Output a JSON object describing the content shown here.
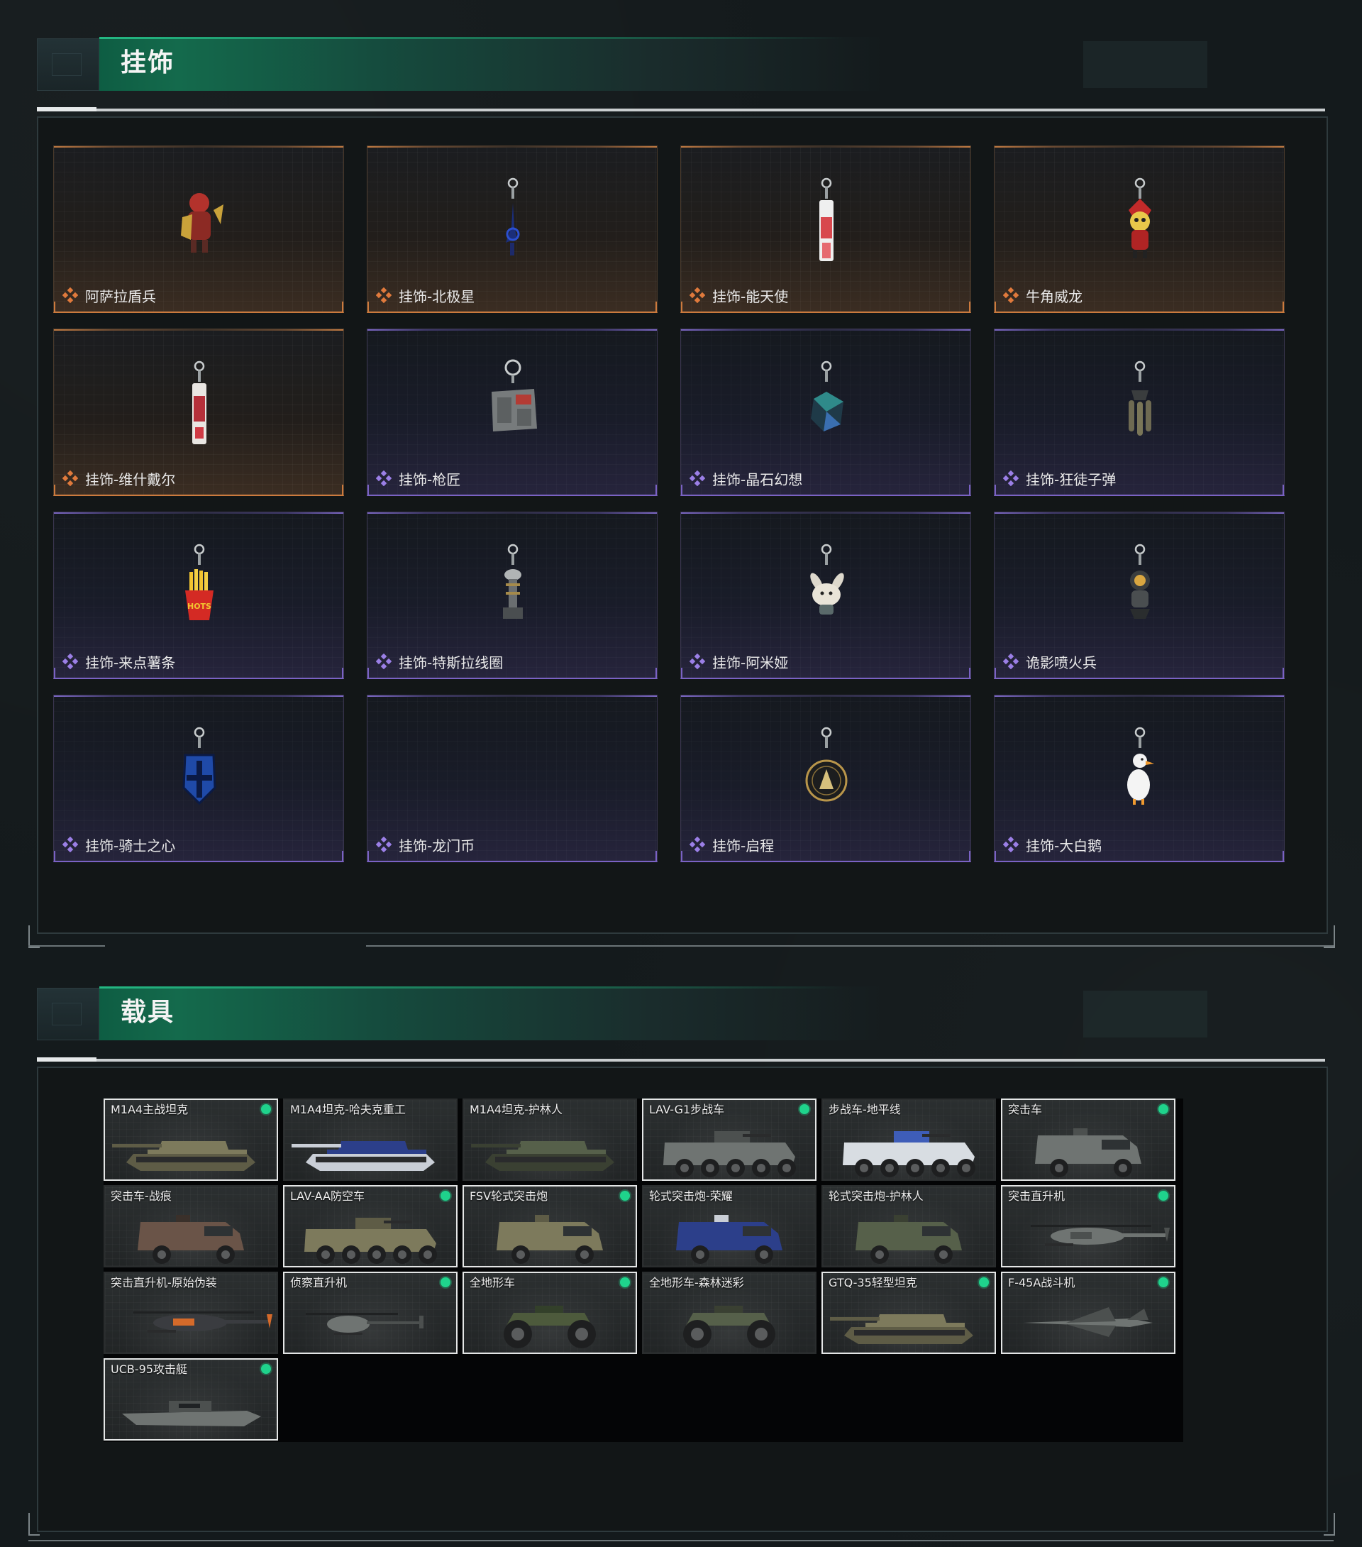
{
  "sections": {
    "charms": {
      "title": "挂饰"
    },
    "vehicles": {
      "title": "载具"
    }
  },
  "colors": {
    "accent_green": "#1fd38c",
    "rarity_gold": "#e07a3c",
    "rarity_purple": "#9b7fe6",
    "header_green": "#146a4c"
  },
  "charms": [
    {
      "label": "阿萨拉盾兵",
      "rarity": "gold",
      "icon": "shield-soldier-figure-icon"
    },
    {
      "label": "挂饰-北极星",
      "rarity": "gold",
      "icon": "polaris-keychain-icon"
    },
    {
      "label": "挂饰-能天使",
      "rarity": "gold",
      "icon": "angel-tag-keychain-icon"
    },
    {
      "label": "牛角威龙",
      "rarity": "gold",
      "icon": "horned-dragon-figure-icon"
    },
    {
      "label": "挂饰-维什戴尔",
      "rarity": "gold",
      "icon": "wisadel-tag-keychain-icon"
    },
    {
      "label": "挂饰-枪匠",
      "rarity": "purple",
      "icon": "gunsmith-case-keychain-icon"
    },
    {
      "label": "挂饰-晶石幻想",
      "rarity": "purple",
      "icon": "crystal-cube-keychain-icon"
    },
    {
      "label": "挂饰-狂徒子弹",
      "rarity": "purple",
      "icon": "bullets-keychain-icon"
    },
    {
      "label": "挂饰-来点薯条",
      "rarity": "purple",
      "icon": "fries-keychain-icon"
    },
    {
      "label": "挂饰-特斯拉线圈",
      "rarity": "purple",
      "icon": "tesla-coil-keychain-icon"
    },
    {
      "label": "挂饰-阿米娅",
      "rarity": "purple",
      "icon": "bunny-keychain-icon"
    },
    {
      "label": "诡影喷火兵",
      "rarity": "purple",
      "icon": "flamethrower-figure-icon"
    },
    {
      "label": "挂饰-骑士之心",
      "rarity": "purple",
      "icon": "knight-shield-keychain-icon"
    },
    {
      "label": "挂饰-龙门币",
      "rarity": "purple",
      "icon": ""
    },
    {
      "label": "挂饰-启程",
      "rarity": "purple",
      "icon": "medal-coin-keychain-icon"
    },
    {
      "label": "挂饰-大白鹅",
      "rarity": "purple",
      "icon": "goose-keychain-icon"
    }
  ],
  "vehicles": [
    {
      "name": "M1A4主战坦克",
      "owned": true,
      "type": "tank",
      "livery": "desert"
    },
    {
      "name": "M1A4坦克-哈夫克重工",
      "owned": false,
      "type": "tank",
      "livery": "blue"
    },
    {
      "name": "M1A4坦克-护林人",
      "owned": false,
      "type": "tank",
      "livery": "camo"
    },
    {
      "name": "LAV-G1步战车",
      "owned": true,
      "type": "apc",
      "livery": "grey"
    },
    {
      "name": "步战车-地平线",
      "owned": false,
      "type": "apc",
      "livery": "white"
    },
    {
      "name": "突击车",
      "owned": true,
      "type": "truck",
      "livery": "grey"
    },
    {
      "name": "突击车-战痕",
      "owned": false,
      "type": "truck",
      "livery": "rust"
    },
    {
      "name": "LAV-AA防空车",
      "owned": true,
      "type": "apc",
      "livery": "desert"
    },
    {
      "name": "FSV轮式突击炮",
      "owned": true,
      "type": "truck",
      "livery": "desert"
    },
    {
      "name": "轮式突击炮-荣耀",
      "owned": false,
      "type": "truck",
      "livery": "blue"
    },
    {
      "name": "轮式突击炮-护林人",
      "owned": false,
      "type": "truck",
      "livery": "camo"
    },
    {
      "name": "突击直升机",
      "owned": true,
      "type": "heli",
      "livery": "grey"
    },
    {
      "name": "突击直升机-原始伪装",
      "owned": false,
      "type": "heli",
      "livery": "orange"
    },
    {
      "name": "侦察直升机",
      "owned": true,
      "type": "heli-small",
      "livery": "grey"
    },
    {
      "name": "全地形车",
      "owned": true,
      "type": "atv",
      "livery": "green"
    },
    {
      "name": "全地形车-森林迷彩",
      "owned": false,
      "type": "atv",
      "livery": "camo"
    },
    {
      "name": "GTQ-35轻型坦克",
      "owned": true,
      "type": "tank",
      "livery": "desert"
    },
    {
      "name": "F-45A战斗机",
      "owned": true,
      "type": "jet",
      "livery": "grey"
    },
    {
      "name": "UCB-95攻击艇",
      "owned": true,
      "type": "boat",
      "livery": "grey"
    }
  ]
}
